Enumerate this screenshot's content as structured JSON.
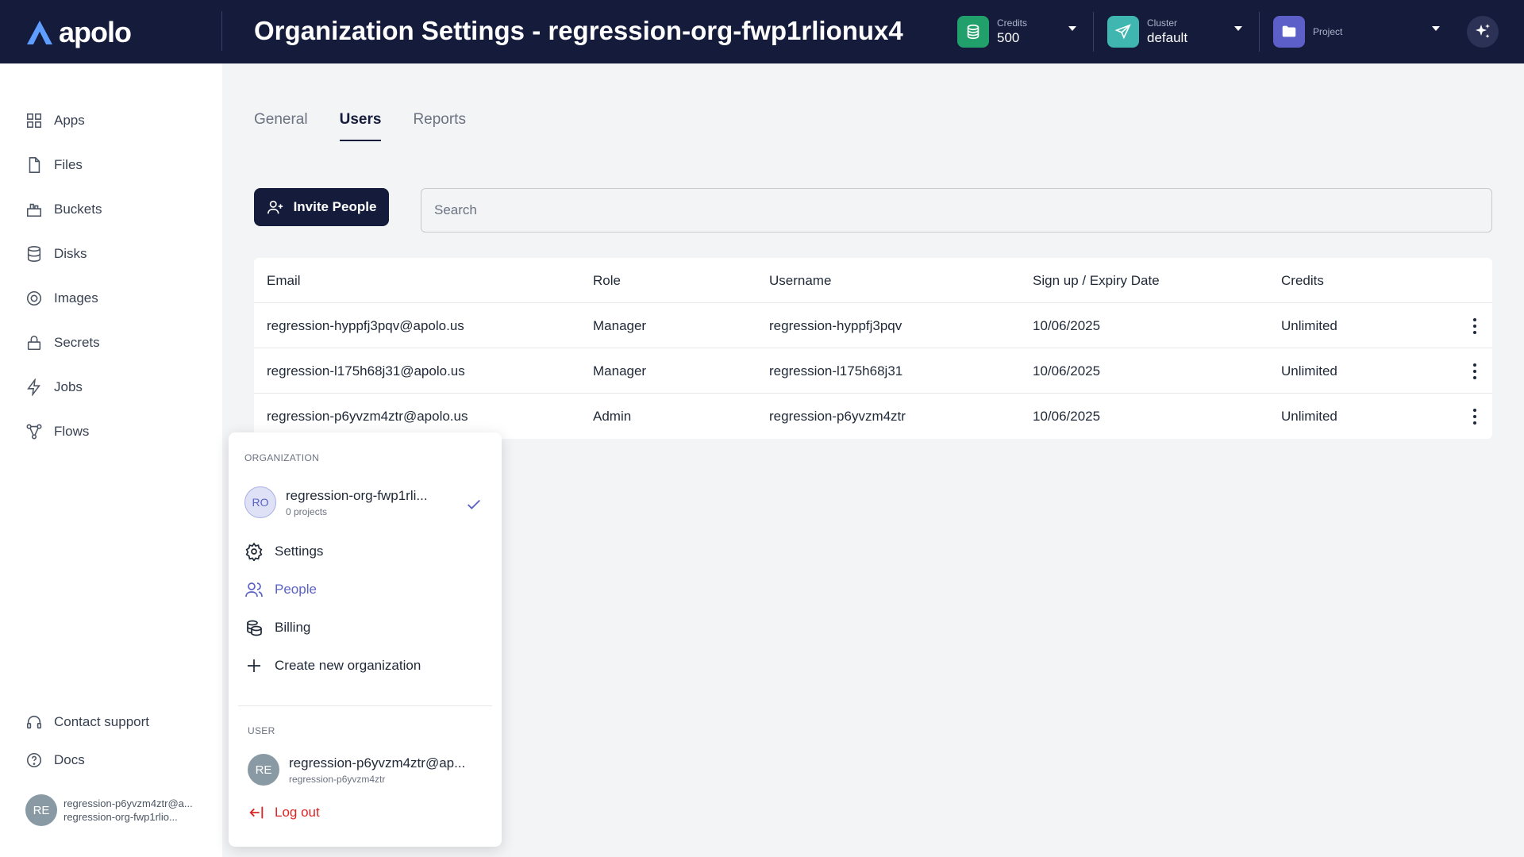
{
  "header": {
    "logo_text": "apolo",
    "title": "Organization Settings - regression-org-fwp1rlionux4",
    "credits": {
      "label": "Credits",
      "value": "500"
    },
    "cluster": {
      "label": "Cluster",
      "value": "default"
    },
    "project": {
      "label": "Project"
    }
  },
  "sidebar": {
    "items": [
      {
        "label": "Apps"
      },
      {
        "label": "Files"
      },
      {
        "label": "Buckets"
      },
      {
        "label": "Disks"
      },
      {
        "label": "Images"
      },
      {
        "label": "Secrets"
      },
      {
        "label": "Jobs"
      },
      {
        "label": "Flows"
      }
    ],
    "contact_support": "Contact support",
    "docs": "Docs",
    "user": {
      "initials": "RE",
      "email": "regression-p6yvzm4ztr@a...",
      "org": "regression-org-fwp1rlio..."
    }
  },
  "tabs": [
    {
      "label": "General",
      "active": false
    },
    {
      "label": "Users",
      "active": true
    },
    {
      "label": "Reports",
      "active": false
    }
  ],
  "toolbar": {
    "invite_label": "Invite People",
    "search_placeholder": "Search"
  },
  "table": {
    "headers": [
      "Email",
      "Role",
      "Username",
      "Sign up / Expiry Date",
      "Credits"
    ],
    "rows": [
      [
        "regression-hyppfj3pqv@apolo.us",
        "Manager",
        "regression-hyppfj3pqv",
        "10/06/2025",
        "Unlimited"
      ],
      [
        "regression-l175h68j31@apolo.us",
        "Manager",
        "regression-l175h68j31",
        "10/06/2025",
        "Unlimited"
      ],
      [
        "regression-p6yvzm4ztr@apolo.us",
        "Admin",
        "regression-p6yvzm4ztr",
        "10/06/2025",
        "Unlimited"
      ]
    ]
  },
  "menu": {
    "org_section": "ORGANIZATION",
    "org": {
      "initials": "RO",
      "name": "regression-org-fwp1rli...",
      "projects": "0 projects"
    },
    "settings": "Settings",
    "people": "People",
    "billing": "Billing",
    "create_org": "Create new organization",
    "user_section": "USER",
    "user": {
      "initials": "RE",
      "email": "regression-p6yvzm4ztr@ap...",
      "username": "regression-p6yvzm4ztr"
    },
    "logout": "Log out"
  },
  "colors": {
    "header_bg": "#151b3b",
    "credits_icon_bg": "#22a06b",
    "cluster_icon_bg": "#3fb6b0",
    "project_icon_bg": "#5b5fc7",
    "accent": "#5a62c4",
    "logout": "#dc2626"
  }
}
